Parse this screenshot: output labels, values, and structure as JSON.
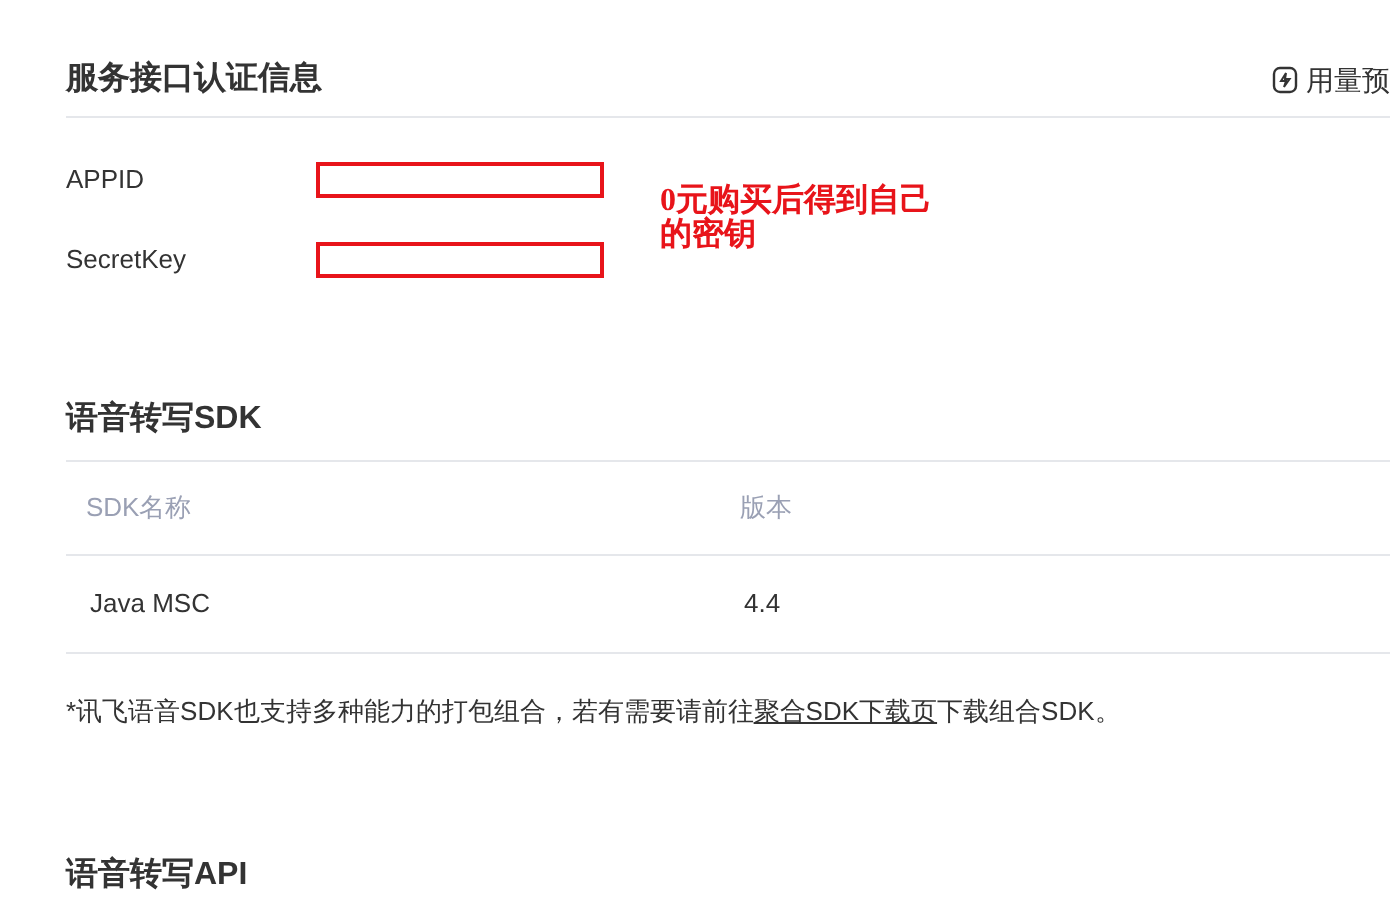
{
  "auth_section": {
    "title": "服务接口认证信息",
    "usage_alert_link": "用量预",
    "fields": [
      {
        "label": "APPID"
      },
      {
        "label": "SecretKey"
      }
    ],
    "annotation": [
      "0元购买后得到自己",
      "的密钥"
    ]
  },
  "sdk_section": {
    "title": "语音转写SDK",
    "table": {
      "columns": [
        "SDK名称",
        "版本"
      ],
      "rows": [
        [
          "Java MSC",
          "4.4"
        ]
      ]
    },
    "note": {
      "before": "*讯飞语音SDK也支持多种能力的打包组合，若有需要请前往",
      "link": "聚合SDK下载页",
      "after": "下载组合SDK。"
    }
  },
  "api_section": {
    "title": "语音转写API"
  }
}
